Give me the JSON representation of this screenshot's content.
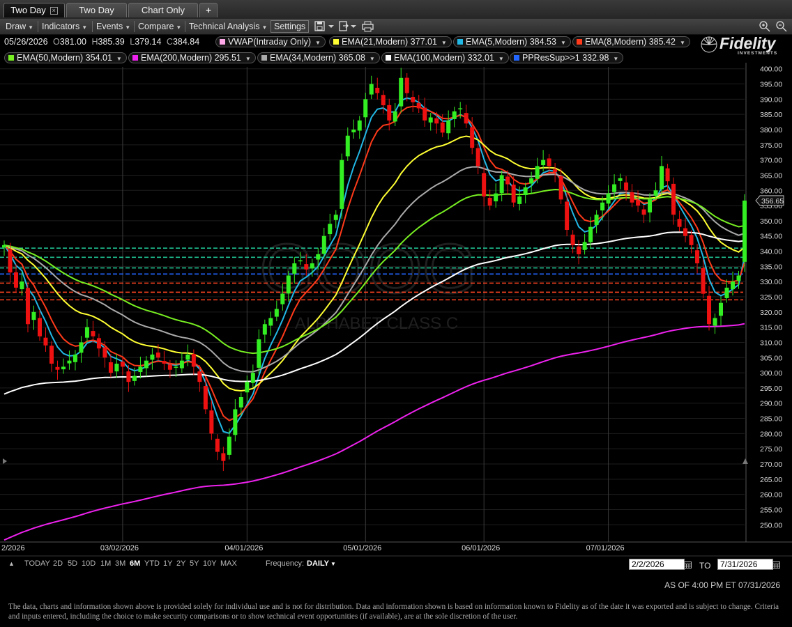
{
  "tabs": [
    {
      "label": "Two Day",
      "active": true,
      "closable": true
    },
    {
      "label": "Two Day",
      "active": false
    },
    {
      "label": "Chart Only",
      "active": false
    }
  ],
  "new_tab_label": "+",
  "toolbar": {
    "draw": "Draw",
    "indicators": "Indicators",
    "events": "Events",
    "compare": "Compare",
    "technical_analysis": "Technical Analysis",
    "settings": "Settings",
    "icons": [
      "save-icon",
      "export-icon",
      "print-icon"
    ],
    "right_icons": [
      "zoom-in-icon",
      "zoom-out-icon"
    ]
  },
  "quote": {
    "date": "05/26/2026",
    "open_label": "O",
    "open": "381.00",
    "high_label": "H",
    "high": "385.39",
    "low_label": "L",
    "low": "379.14",
    "close_label": "C",
    "close": "384.84"
  },
  "studies": [
    {
      "label": "VWAP(Intraday Only)",
      "value": "",
      "color": "#ffa8e8"
    },
    {
      "label": "EMA(21,Modern)",
      "value": "377.01",
      "color": "#ffff33"
    },
    {
      "label": "EMA(5,Modern)",
      "value": "384.53",
      "color": "#22b8e6"
    },
    {
      "label": "EMA(8,Modern)",
      "value": "385.42",
      "color": "#ff3a1a"
    },
    {
      "label": "EMA(50,Modern)",
      "value": "354.01",
      "color": "#77ee22"
    },
    {
      "label": "EMA(200,Modern)",
      "value": "295.51",
      "color": "#ee22ee"
    },
    {
      "label": "EMA(34,Modern)",
      "value": "365.08",
      "color": "#aaaaaa"
    },
    {
      "label": "EMA(100,Modern)",
      "value": "332.01",
      "color": "#ffffff"
    },
    {
      "label": "PPResSup>>1",
      "value": "332.98",
      "color": "#2266ff"
    }
  ],
  "brand": "Fidelity",
  "brand_sub": "INVESTMENTS",
  "bottom": {
    "ranges": [
      "TODAY",
      "2D",
      "5D",
      "10D",
      "1M",
      "3M",
      "6M",
      "YTD",
      "1Y",
      "2Y",
      "5Y",
      "10Y",
      "MAX"
    ],
    "selected_range": "6M",
    "frequency_label": "Frequency:",
    "frequency_value": "DAILY",
    "from_date": "2/2/2026",
    "to_label": "TO",
    "to_date": "7/31/2026"
  },
  "as_of": "AS OF 4:00 PM ET 07/31/2026",
  "disclaimer": "The data, charts and information shown above is provided solely for individual use and is not for distribution.  Data and information shown is based on information known to Fidelity as of the date it was exported and is subject to change. Criteria and inputs entered, including the choice to make security comparisons or to show technical event opportunities (if available), are at the sole discretion of the user.",
  "chart_data": {
    "type": "candlestick",
    "watermark_symbol": "GOOG",
    "watermark_name": "ALPHABET CLASS C",
    "last_price_label": "356.65",
    "ylim": [
      248,
      402
    ],
    "y_ticks": [
      400,
      395,
      390,
      385,
      380,
      375,
      370,
      365,
      360,
      355,
      350,
      345,
      340,
      335,
      330,
      325,
      320,
      315,
      310,
      305,
      300,
      295,
      290,
      285,
      280,
      275,
      270,
      265,
      260,
      255,
      250
    ],
    "x_ticks": [
      "2/2026",
      "03/02/2026",
      "04/01/2026",
      "05/01/2026",
      "06/01/2026",
      "07/01/2026"
    ],
    "x_tick_index": [
      0,
      20,
      41,
      61,
      81,
      102
    ],
    "grid": true,
    "support_resistance_levels": [
      {
        "value": 341,
        "color": "#1fbf8f"
      },
      {
        "value": 338,
        "color": "#1fbf8f"
      },
      {
        "value": 334.5,
        "color": "#1fbf8f"
      },
      {
        "value": 332.5,
        "color": "#2266ff"
      },
      {
        "value": 329.5,
        "color": "#ff4422"
      },
      {
        "value": 326.5,
        "color": "#ff4422"
      },
      {
        "value": 324,
        "color": "#ff4422"
      }
    ],
    "closes": [
      342,
      333,
      328,
      330,
      316,
      320,
      312,
      309,
      303,
      301,
      302,
      304,
      306,
      310,
      315,
      312,
      308,
      305,
      300,
      303,
      302,
      297,
      299,
      302,
      304,
      306,
      305,
      303,
      301,
      302,
      304,
      306,
      302,
      297,
      288,
      280,
      274,
      271,
      279,
      288,
      292,
      297,
      300,
      311,
      316,
      318,
      321,
      326,
      332,
      336,
      337,
      334,
      336,
      339,
      345,
      349,
      352,
      370,
      378,
      380,
      383,
      390,
      395,
      392,
      388,
      383,
      386,
      397,
      392,
      389,
      387,
      383,
      384,
      382,
      379,
      383,
      386,
      387,
      382,
      374,
      368,
      358,
      355,
      359,
      365,
      362,
      356,
      358,
      361,
      364,
      368,
      370,
      368,
      366,
      357,
      347,
      342,
      339,
      343,
      348,
      352,
      356,
      359,
      362,
      364,
      360,
      356,
      355,
      352,
      357,
      360,
      368,
      363,
      352,
      348,
      345,
      342,
      336,
      326,
      316,
      318,
      323,
      328,
      330,
      332,
      356.65
    ],
    "series": [
      {
        "name": "EMA(5,Modern)",
        "period": 5,
        "color": "#22b8e6"
      },
      {
        "name": "EMA(8,Modern)",
        "period": 8,
        "color": "#ff3a1a"
      },
      {
        "name": "EMA(21,Modern)",
        "period": 21,
        "color": "#ffff33"
      },
      {
        "name": "EMA(34,Modern)",
        "period": 34,
        "color": "#aaaaaa"
      },
      {
        "name": "EMA(50,Modern)",
        "period": 50,
        "color": "#77ee22"
      },
      {
        "name": "EMA(100,Modern)",
        "period": 100,
        "color": "#ffffff",
        "seed": 292
      },
      {
        "name": "EMA(200,Modern)",
        "period": 200,
        "color": "#ee22ee",
        "seed": 244
      }
    ]
  }
}
